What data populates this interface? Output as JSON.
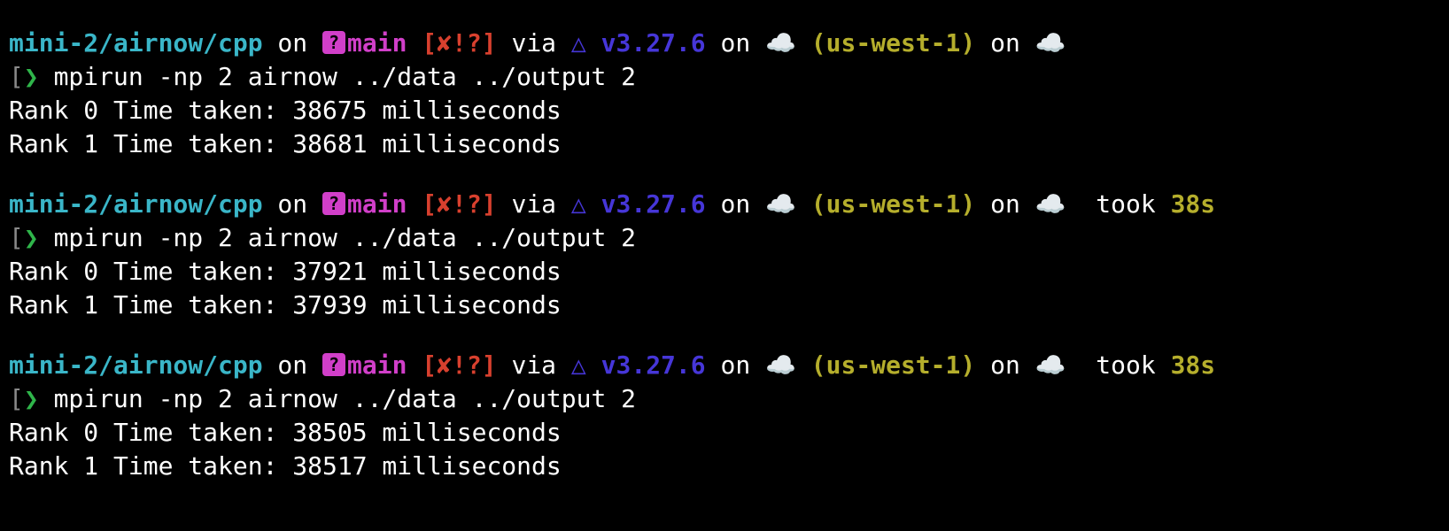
{
  "terminal": {
    "sessions": [
      {
        "prompt": {
          "path": "mini-2/airnow/cpp",
          "on1": " on ",
          "branch_icon": "?",
          "branch": "main",
          "status": " [✘!?]",
          "via": " via ",
          "cmake_icon": "△",
          "version": " v3.27.6",
          "on2": " on ",
          "cloud1": "☁️",
          "region": " (us-west-1)",
          "on3": " on ",
          "cloud2": "☁️",
          "took_label": "",
          "took_value": ""
        },
        "bracket": "[",
        "caret": "❯",
        "command": " mpirun -np 2 airnow ../data ../output 2",
        "output": [
          "Rank 0 Time taken: 38675 milliseconds",
          "Rank 1 Time taken: 38681 milliseconds"
        ]
      },
      {
        "prompt": {
          "path": "mini-2/airnow/cpp",
          "on1": " on ",
          "branch_icon": "?",
          "branch": "main",
          "status": " [✘!?]",
          "via": " via ",
          "cmake_icon": "△",
          "version": " v3.27.6",
          "on2": " on ",
          "cloud1": "☁️",
          "region": " (us-west-1)",
          "on3": " on ",
          "cloud2": "☁️",
          "took_label": "  took ",
          "took_value": "38s"
        },
        "bracket": "[",
        "caret": "❯",
        "command": " mpirun -np 2 airnow ../data ../output 2",
        "output": [
          "Rank 0 Time taken: 37921 milliseconds",
          "Rank 1 Time taken: 37939 milliseconds"
        ]
      },
      {
        "prompt": {
          "path": "mini-2/airnow/cpp",
          "on1": " on ",
          "branch_icon": "?",
          "branch": "main",
          "status": " [✘!?]",
          "via": " via ",
          "cmake_icon": "△",
          "version": " v3.27.6",
          "on2": " on ",
          "cloud1": "☁️",
          "region": " (us-west-1)",
          "on3": " on ",
          "cloud2": "☁️",
          "took_label": "  took ",
          "took_value": "38s"
        },
        "bracket": "[",
        "caret": "❯",
        "command": " mpirun -np 2 airnow ../data ../output 2",
        "output": [
          "Rank 0 Time taken: 38505 milliseconds",
          "Rank 1 Time taken: 38517 milliseconds"
        ]
      }
    ]
  }
}
